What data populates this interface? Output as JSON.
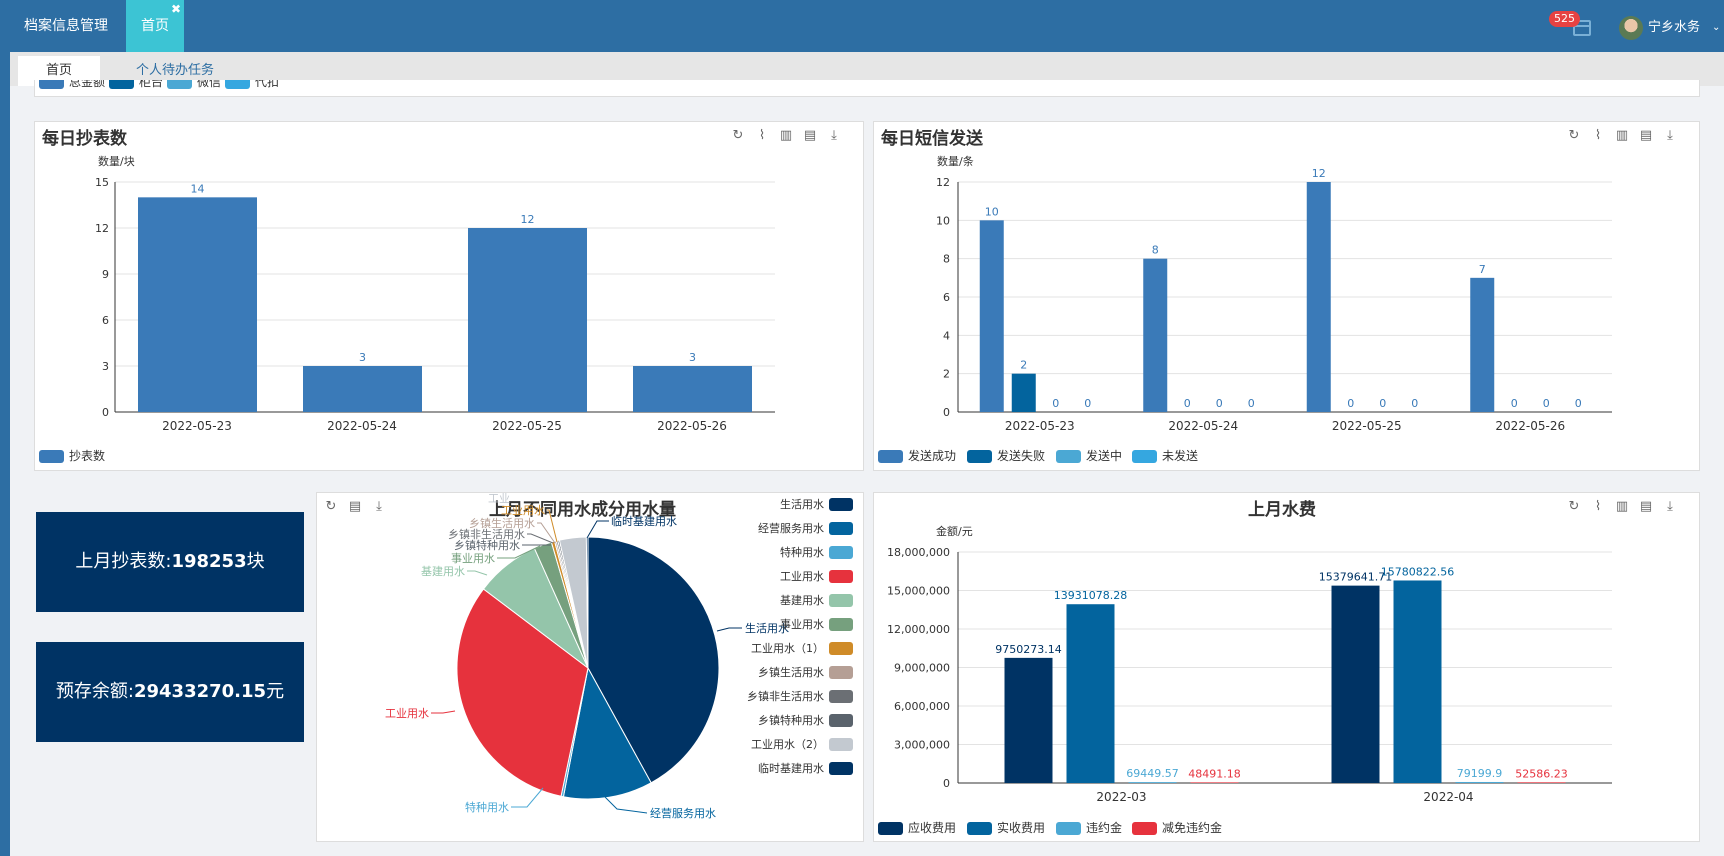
{
  "topbar": {
    "menu_item": "档案信息管理",
    "active_tab": "首页",
    "close_glyph": "✖",
    "notification_count": "525",
    "user_name": "宁乡水务",
    "dropdown_glyph": "⌄",
    "icons": [
      "calendar-icon",
      "avatar",
      "chevron-down-icon"
    ]
  },
  "subtabs": [
    {
      "label": "首页"
    },
    {
      "label": "个人待办任务"
    }
  ],
  "top_legend": [
    {
      "label": "总金额",
      "color": "#3a7ab8"
    },
    {
      "label": "柜台",
      "color": "#03649e"
    },
    {
      "label": "微信",
      "color": "#4ba8d4"
    },
    {
      "label": "代扣",
      "color": "#35a7e0"
    }
  ],
  "toolbox_icons": [
    "refresh-icon",
    "line-chart-icon",
    "bar-chart-icon",
    "data-view-icon",
    "download-icon"
  ],
  "stats": {
    "monthly_reads_label": "上月抄表数:",
    "monthly_reads_value": "198253",
    "monthly_reads_unit": "块",
    "balance_label": "预存余额:",
    "balance_value": "29433270.15",
    "balance_unit": "元"
  },
  "chart_data": [
    {
      "id": "daily_reads",
      "type": "bar",
      "title": "每日抄表数",
      "ylabel": "数量/块",
      "categories": [
        "2022-05-23",
        "2022-05-24",
        "2022-05-25",
        "2022-05-26"
      ],
      "series": [
        {
          "name": "抄表数",
          "values": [
            14,
            3,
            12,
            3
          ],
          "color": "#3a7ab8"
        }
      ],
      "ylim": [
        0,
        15
      ],
      "yticks": [
        "0",
        "3",
        "6",
        "9",
        "12",
        "15"
      ],
      "grid": true,
      "legend": "bottom-left"
    },
    {
      "id": "daily_sms",
      "type": "bar",
      "title": "每日短信发送",
      "ylabel": "数量/条",
      "categories": [
        "2022-05-23",
        "2022-05-24",
        "2022-05-25",
        "2022-05-26"
      ],
      "series": [
        {
          "name": "发送成功",
          "values": [
            10,
            8,
            12,
            7
          ],
          "color": "#3a7ab8"
        },
        {
          "name": "发送失败",
          "values": [
            2,
            0,
            0,
            0
          ],
          "color": "#03649e"
        },
        {
          "name": "发送中",
          "values": [
            0,
            0,
            0,
            0
          ],
          "color": "#4ba8d4"
        },
        {
          "name": "未发送",
          "values": [
            0,
            0,
            0,
            0
          ],
          "color": "#35a7e0"
        }
      ],
      "ylim": [
        0,
        12
      ],
      "yticks": [
        "0",
        "2",
        "4",
        "6",
        "8",
        "10",
        "12"
      ],
      "grid": true,
      "legend": "bottom-left"
    },
    {
      "id": "water_usage_pie",
      "type": "pie",
      "title": "上月不同用水成分用水量",
      "slices": [
        {
          "name": "生活用水",
          "value": 42,
          "color": "#003364"
        },
        {
          "name": "经营服务用水",
          "value": 11,
          "color": "#03649e"
        },
        {
          "name": "特种用水",
          "value": 0.3,
          "color": "#4ba8d4"
        },
        {
          "name": "工业用水",
          "value": 32,
          "color": "#e6323d"
        },
        {
          "name": "基建用水",
          "value": 8,
          "color": "#94c5aa"
        },
        {
          "name": "事业用水",
          "value": 2.2,
          "color": "#76a07e"
        },
        {
          "name": "工业用水（1）",
          "value": 0.4,
          "color": "#cf8b28"
        },
        {
          "name": "乡镇生活用水",
          "value": 0.2,
          "color": "#b59f95"
        },
        {
          "name": "乡镇非生活用水",
          "value": 0.2,
          "color": "#6b6f74"
        },
        {
          "name": "乡镇特种用水",
          "value": 0.2,
          "color": "#5a636c"
        },
        {
          "name": "工业用水（2）",
          "value": 3.3,
          "color": "#c3c9d0"
        },
        {
          "name": "临时基建用水",
          "value": 0.2,
          "color": "#003364"
        }
      ],
      "label_texts": {
        "shenghuo": "生活用水",
        "jingying": "经营服务用水",
        "tezhong": "特种用水",
        "gongye": "工业用水",
        "jijian": "基建用水",
        "shiye": "事业用水",
        "xiangzhen_tezhong": "乡镇特种用水",
        "xiangzhen_feishenghuo": "乡镇非生活用水",
        "xiangzhen_shenghuo": "乡镇生活用水",
        "gongye_1": "工业用水",
        "gongye_2": "工业",
        "linshi": "临时基建用水"
      },
      "legend": "right"
    },
    {
      "id": "monthly_fees",
      "type": "bar",
      "title": "上月水费",
      "ylabel": "金额/元",
      "categories": [
        "2022-03",
        "2022-04"
      ],
      "series": [
        {
          "name": "应收费用",
          "values": [
            9750273.14,
            15379641.71
          ],
          "labels": [
            "9750273.14",
            "15379641.71"
          ],
          "color": "#003364",
          "label_color": "#003364"
        },
        {
          "name": "实收费用",
          "values": [
            13931078.28,
            15780822.56
          ],
          "labels": [
            "13931078.28",
            "15780822.56"
          ],
          "color": "#03649e",
          "label_color": "#03649e"
        },
        {
          "name": "违约金",
          "values": [
            69449.57,
            79199.9
          ],
          "labels": [
            "69449.57",
            "79199.9"
          ],
          "color": "#4ba8d4",
          "label_color": "#4ba8d4"
        },
        {
          "name": "减免违约金",
          "values": [
            48491.18,
            52586.23
          ],
          "labels": [
            "48491.18",
            "52586.23"
          ],
          "color": "#e6323d",
          "label_color": "#e6323d"
        }
      ],
      "ylim": [
        0,
        18000000
      ],
      "yticks": [
        "0",
        "3,000,000",
        "6,000,000",
        "9,000,000",
        "12,000,000",
        "15,000,000",
        "18,000,000"
      ],
      "grid": true,
      "legend": "bottom-left"
    }
  ]
}
